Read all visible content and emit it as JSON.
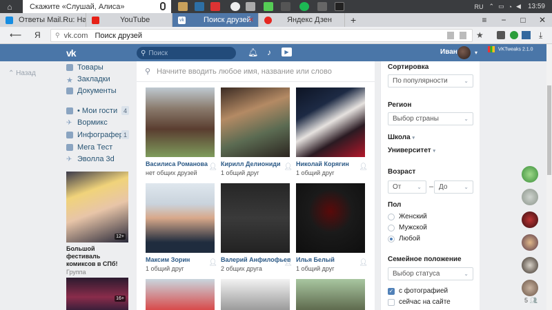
{
  "taskbar": {
    "alice_placeholder": "Скажите «Слушай, Алиса»",
    "lang": "RU",
    "time": "13:59"
  },
  "tabs": [
    {
      "label": "Ответы Mail.Ru: Найти чел",
      "favicon_color": "#168de2"
    },
    {
      "label": "YouTube",
      "favicon_color": "#e62117"
    },
    {
      "label": "Поиск друзей",
      "favicon_color": "#ffffff",
      "active": true
    },
    {
      "label": "Яндекс Дзен",
      "favicon_color": "#e52620"
    }
  ],
  "addressbar": {
    "yandex_logo": "Я",
    "domain": "vk.com",
    "page_title": "Поиск друзей"
  },
  "header": {
    "logo": "vk",
    "search_placeholder": "Поиск",
    "user_name": "Иван",
    "tweak": "VKTweaks 2.1.0"
  },
  "leftnav": {
    "back_label": "Назад",
    "items": [
      {
        "label": "Товары",
        "count": ""
      },
      {
        "label": "Закладки",
        "count": ""
      },
      {
        "label": "Документы",
        "count": ""
      },
      {
        "label": "• Мои гости",
        "count": "4"
      },
      {
        "label": "Вормикс",
        "count": ""
      },
      {
        "label": "Инфографер",
        "count": "1"
      },
      {
        "label": "Мега Тест",
        "count": ""
      },
      {
        "label": "Эволла 3d",
        "count": ""
      }
    ],
    "ads": [
      {
        "title": "Большой фестиваль комиксов в СПб!",
        "subtitle": "Группа",
        "badge": "12+"
      },
      {
        "title": "",
        "subtitle": "",
        "badge": "16+"
      }
    ]
  },
  "search": {
    "placeholder": "Начните вводить любое имя, название или слово"
  },
  "people": [
    {
      "name": "Василиса Романова",
      "mutual": "нет общих друзей"
    },
    {
      "name": "Кирилл Делиониди",
      "mutual": "1 общий друг"
    },
    {
      "name": "Николай Корягин",
      "mutual": "1 общий друг"
    },
    {
      "name": "Максим Зорин",
      "mutual": "1 общий друг"
    },
    {
      "name": "Валерий Анфилофьев",
      "mutual": "2 общих друга"
    },
    {
      "name": "Илья Белый",
      "mutual": "1 общий друг"
    },
    {
      "name": "",
      "mutual": ""
    },
    {
      "name": "",
      "mutual": ""
    },
    {
      "name": "",
      "mutual": ""
    }
  ],
  "filters": {
    "sort_label": "Сортировка",
    "sort_value": "По популярности",
    "region_label": "Регион",
    "region_value": "Выбор страны",
    "school_label": "Школа",
    "university_label": "Университет",
    "age_label": "Возраст",
    "age_from": "От",
    "age_dash": "–",
    "age_to": "До",
    "gender_label": "Пол",
    "gender_options": [
      "Женский",
      "Мужской",
      "Любой"
    ],
    "gender_selected": "Любой",
    "marital_label": "Семейное положение",
    "marital_value": "Выбор статуса",
    "with_photo": "с фотографией",
    "online_now": "сейчас на сайте",
    "with_photo_checked": true,
    "online_now_checked": false
  },
  "rightbar": {
    "count": "5"
  },
  "colors": {
    "accent": "#4a76a8",
    "link": "#2a5885"
  }
}
